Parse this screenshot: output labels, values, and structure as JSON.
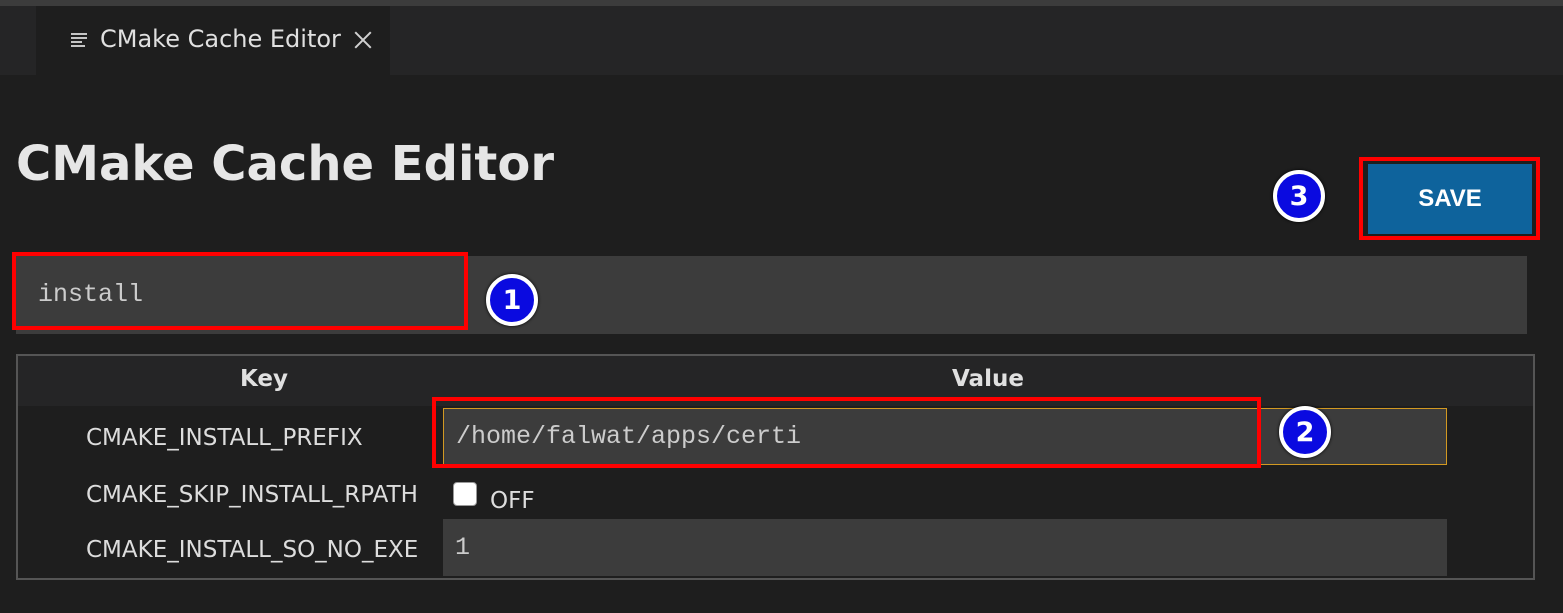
{
  "tab": {
    "label": "CMake Cache Editor",
    "icon": "list-icon"
  },
  "page": {
    "title": "CMake Cache Editor"
  },
  "toolbar": {
    "save_label": "SAVE"
  },
  "search": {
    "value": "install"
  },
  "table": {
    "headers": {
      "key": "Key",
      "value": "Value"
    },
    "rows": [
      {
        "key": "CMAKE_INSTALL_PREFIX",
        "type": "text",
        "value": "/home/falwat/apps/certi"
      },
      {
        "key": "CMAKE_SKIP_INSTALL_RPATH",
        "type": "bool",
        "value": "OFF"
      },
      {
        "key": "CMAKE_INSTALL_SO_NO_EXE",
        "type": "text",
        "value": "1"
      }
    ]
  },
  "annotations": {
    "m1": "1",
    "m2": "2",
    "m3": "3"
  },
  "colors": {
    "accent": "#0e639c",
    "highlight": "#ff0000",
    "marker": "#0a0ae0",
    "focus_border": "#d29922"
  }
}
